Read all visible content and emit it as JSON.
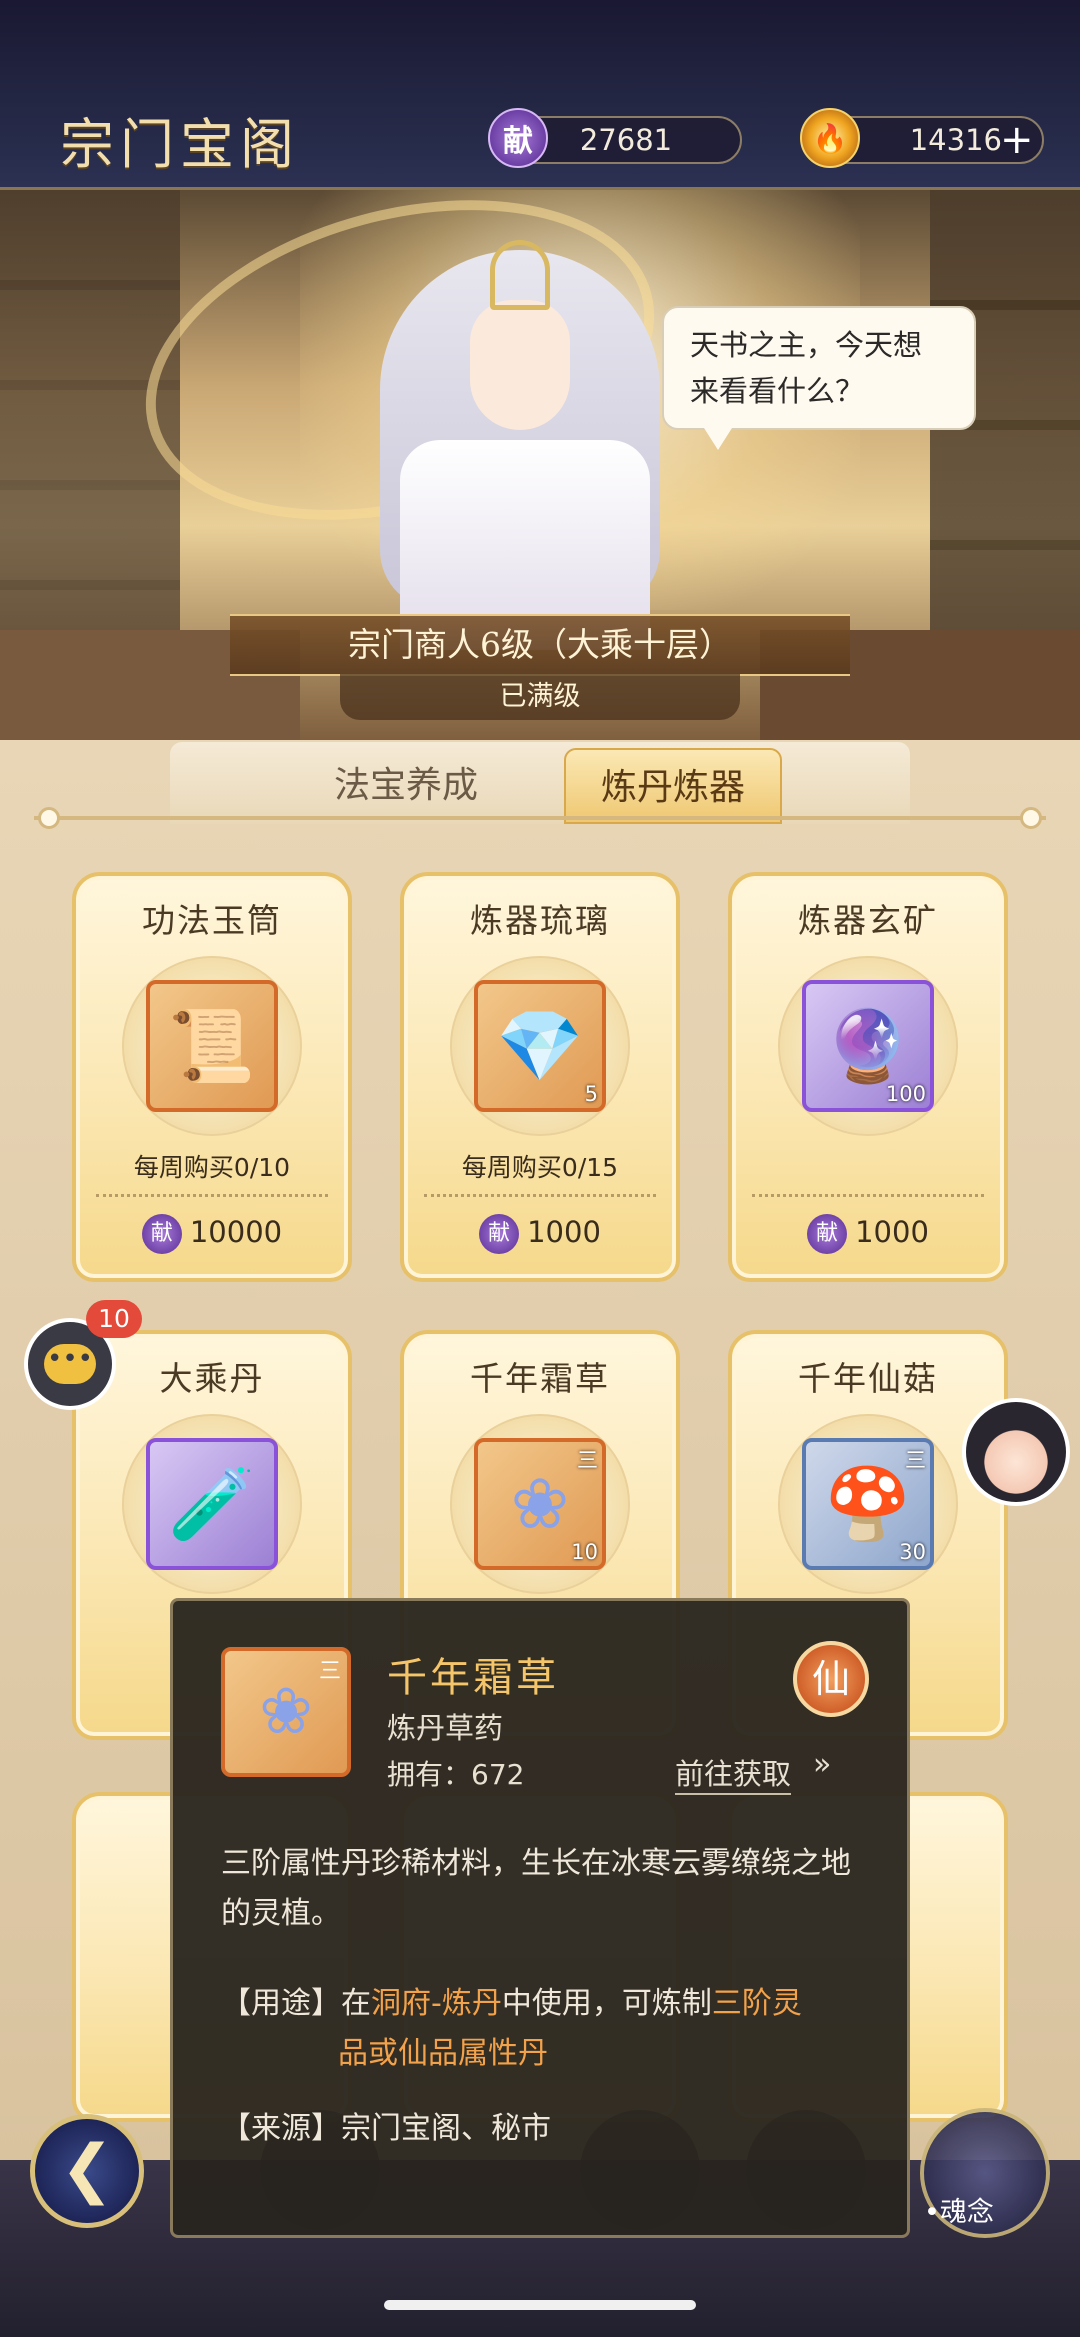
{
  "header": {
    "title": "宗门宝阁",
    "currency_xian": {
      "icon": "献",
      "value": "27681"
    },
    "currency_flame": {
      "icon": "flame-icon",
      "value": "14316",
      "add": "+"
    }
  },
  "merchant": {
    "speech": "天书之主，今天想来看看什么？",
    "rank": "宗门商人6级（大乘十层）",
    "rank_status": "已满级"
  },
  "tabs": [
    {
      "label": "法宝养成",
      "active": false
    },
    {
      "label": "炼丹炼器",
      "active": true
    }
  ],
  "cards": [
    {
      "name": "功法玉筒",
      "qty": "",
      "tier": "",
      "limit": "每周购买0/10",
      "price": "10000",
      "price_icon": "献",
      "frame": "orange",
      "glyph": "📜"
    },
    {
      "name": "炼器琉璃",
      "qty": "5",
      "tier": "",
      "limit": "每周购买0/15",
      "price": "1000",
      "price_icon": "献",
      "frame": "orange",
      "glyph": "💎"
    },
    {
      "name": "炼器玄矿",
      "qty": "100",
      "tier": "",
      "limit": "",
      "price": "1000",
      "price_icon": "献",
      "frame": "purple",
      "glyph": "🔮"
    },
    {
      "name": "大乘丹",
      "qty": "",
      "tier": "",
      "limit": "",
      "price": "",
      "price_icon": "",
      "frame": "purple",
      "glyph": "🧪"
    },
    {
      "name": "千年霜草",
      "qty": "10",
      "tier": "三",
      "limit": "",
      "price": "",
      "price_icon": "",
      "frame": "orange",
      "glyph": "❀"
    },
    {
      "name": "千年仙菇",
      "qty": "30",
      "tier": "三",
      "limit": "",
      "price": "",
      "price_icon": "",
      "frame": "blue",
      "glyph": "🍄"
    }
  ],
  "chat": {
    "badge": "10"
  },
  "tooltip": {
    "name": "千年霜草",
    "tier": "三",
    "type": "炼丹草药",
    "owned": "拥有：672",
    "goto": "前往获取",
    "badge": "仙",
    "description": "三阶属性丹珍稀材料，生长在冰寒云雾缭绕之地的灵植。",
    "use_label": "【用途】",
    "use_pre": "在",
    "use_place": "洞府-炼丹",
    "use_mid": "中使用，可炼制",
    "use_result_1": "三阶灵",
    "use_result_2": "品或仙品属性丹",
    "source": "【来源】宗门宝阁、秘市"
  },
  "bottom_nav": {
    "soul_label": "•魂念"
  }
}
